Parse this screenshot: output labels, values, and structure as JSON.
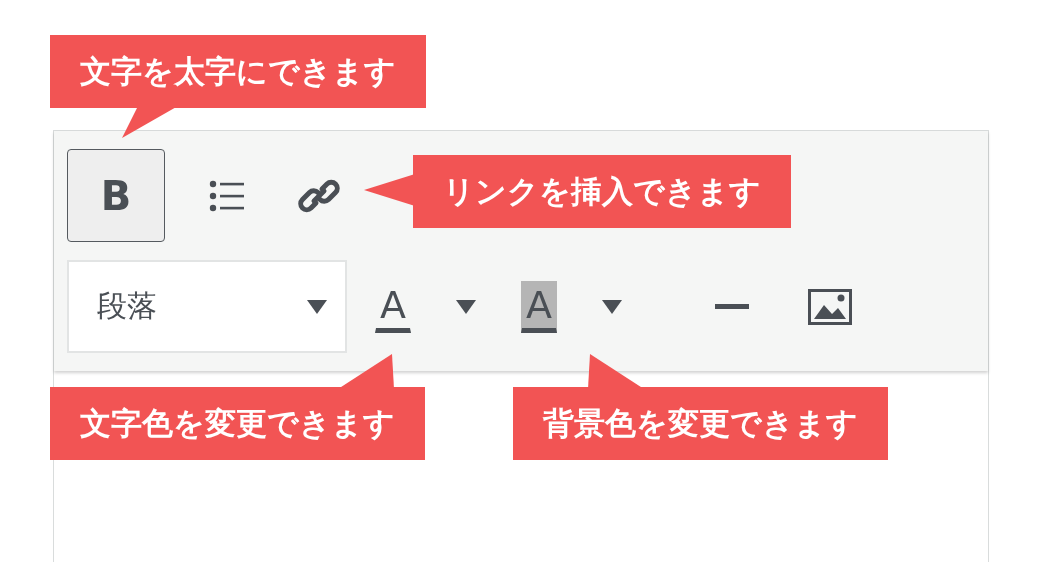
{
  "toolbar": {
    "rows": [
      [
        {
          "kind": "bold",
          "label": "B",
          "selected": true
        },
        {
          "kind": "list",
          "selected": false
        },
        {
          "kind": "link",
          "selected": false
        }
      ],
      [
        {
          "kind": "dropdown",
          "value": "段落"
        },
        {
          "kind": "text-color",
          "label": "A"
        },
        {
          "kind": "caret"
        },
        {
          "kind": "highlight",
          "label": "A"
        },
        {
          "kind": "caret"
        },
        {
          "kind": "rule"
        },
        {
          "kind": "image"
        }
      ]
    ]
  },
  "callouts": [
    {
      "text": "文字を太字にできます"
    },
    {
      "text": "リンクを挿入できます"
    },
    {
      "text": "文字色を変更できます"
    },
    {
      "text": "背景色を変更できます"
    }
  ]
}
